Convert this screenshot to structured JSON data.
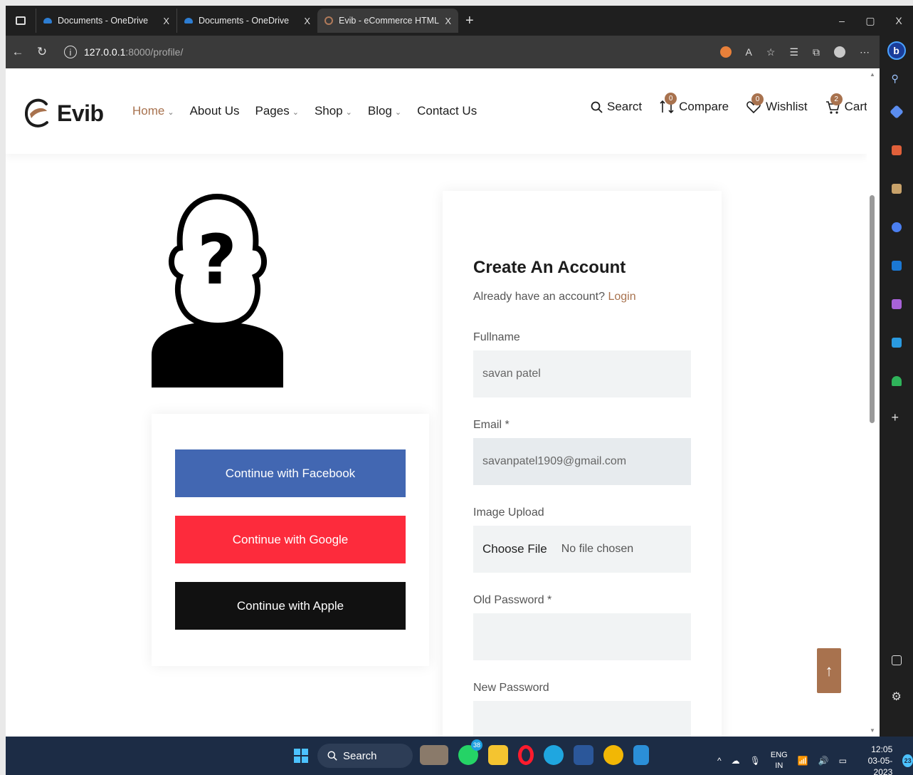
{
  "browser": {
    "tabs": [
      {
        "title": "Documents - OneDrive",
        "close": "X"
      },
      {
        "title": "Documents - OneDrive",
        "close": "X"
      },
      {
        "title": "Evib - eCommerce HTML Templa",
        "close": "X"
      }
    ],
    "new_tab": "+",
    "window_controls": {
      "minimize": "–",
      "restore": "▢",
      "close": "X"
    },
    "url_host": "127.0.0.1",
    "url_path": ":8000/profile/",
    "copilot_label": "b"
  },
  "site": {
    "logo_text": "Evib",
    "nav": [
      {
        "label": "Home",
        "chevron": "⌄"
      },
      {
        "label": "About Us",
        "chevron": ""
      },
      {
        "label": "Pages",
        "chevron": "⌄"
      },
      {
        "label": "Shop",
        "chevron": "⌄"
      },
      {
        "label": "Blog",
        "chevron": "⌄"
      },
      {
        "label": "Contact Us",
        "chevron": ""
      }
    ],
    "search_label": "Searct",
    "compare_label": "Compare",
    "compare_count": "0",
    "wishlist_label": "Wishlist",
    "wishlist_count": "0",
    "cart_label": "Cart",
    "cart_count": "2"
  },
  "social": {
    "facebook": "Continue with Facebook",
    "google": "Continue with Google",
    "apple": "Continue with Apple"
  },
  "form": {
    "title": "Create An Account",
    "subtitle": "Already have an account?",
    "login_link": "Login",
    "fullname_label": "Fullname",
    "fullname_value": "savan patel",
    "email_label": "Email *",
    "email_value": "savanpatel1909@gmail.com",
    "image_label": "Image Upload",
    "choose_file": "Choose File",
    "no_file": "No file chosen",
    "old_password_label": "Old Password *",
    "new_password_label": "New Password"
  },
  "scroll_top_icon": "↑",
  "taskbar": {
    "search_label": "Search",
    "whatsapp_badge": "38",
    "lang_line1": "ENG",
    "lang_line2": "IN",
    "time": "12:05",
    "date": "03-05-2023",
    "notification_count": "23"
  },
  "colors": {
    "accent": "#a8724e",
    "facebook": "#4267b2",
    "google": "#fd2b3c",
    "apple": "#111111"
  }
}
